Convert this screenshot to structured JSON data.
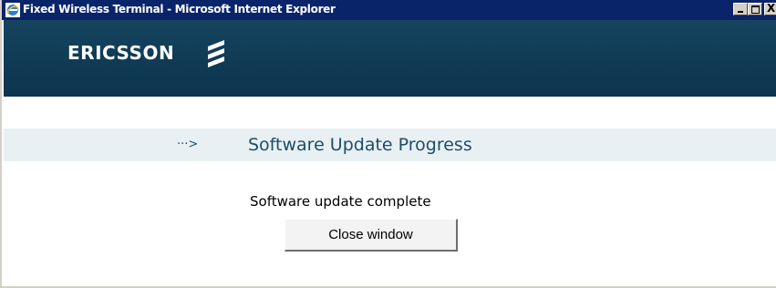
{
  "window": {
    "title": "Fixed Wireless Terminal - Microsoft Internet Explorer",
    "close_glyph": "X"
  },
  "header": {
    "logo_text": "ERICSSON",
    "logo_icon": "ericsson-logo-icon"
  },
  "section": {
    "arrow": "···>",
    "heading": "Software Update Progress"
  },
  "main": {
    "status_text": "Software update complete",
    "close_button_label": "Close window"
  },
  "colors": {
    "titlebar": "#0a246a",
    "header_bg": "#0f3a54",
    "section_bar_bg": "#e9f0f3",
    "heading_text": "#1b4e6b"
  }
}
